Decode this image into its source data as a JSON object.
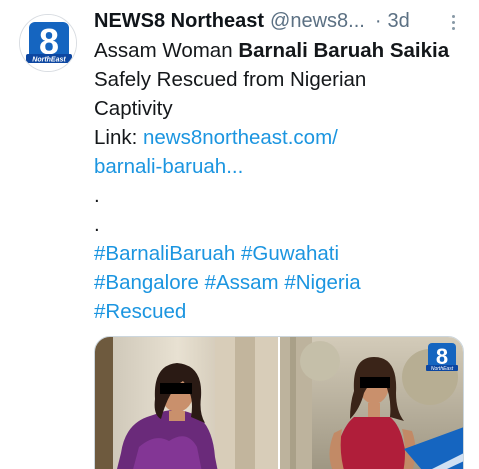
{
  "tweet": {
    "author_name": "NEWS8 Northeast",
    "author_handle": "@news8...",
    "separator": "·",
    "timestamp": "3d",
    "avatar": {
      "big_text": "8",
      "small_text": "NorthEast",
      "color": "#1565c0"
    },
    "text": {
      "line1_prefix": "Assam Woman ",
      "line1_bold": "Barnali Baruah Saikia",
      "line2": "Safely Rescued from Nigerian",
      "line3": "Captivity",
      "link_prefix": "Link: ",
      "link_part1": "news8northeast.com/",
      "link_part2": "barnali-baruah...",
      "dot1": ".",
      "dot2": "."
    },
    "hashtags": [
      "#BarnaliBaruah",
      "#Guwahati",
      "#Bangalore",
      "#Assam",
      "#Nigeria",
      "#Rescued"
    ],
    "media": {
      "photo1_icon": "woman-purple-dress-photo",
      "photo2_icon": "woman-red-dress-photo",
      "watermark_big": "8",
      "watermark_small": "NorthEast"
    }
  },
  "colors": {
    "link": "#1b95e0",
    "muted": "#5b7083",
    "brand": "#1565c0"
  }
}
